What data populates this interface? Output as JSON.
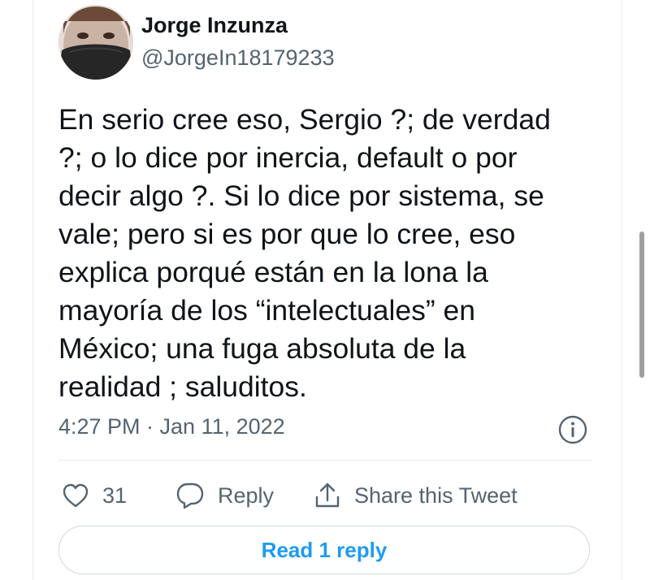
{
  "author": {
    "name": "Jorge Inzunza",
    "handle": "@JorgeIn18179233"
  },
  "tweet": {
    "text": "En serio cree eso, Sergio ?; de verdad\n?; o lo dice por inercia, default o por\ndecir algo ?. Si lo dice por sistema, se\nvale; pero si es por que lo cree, eso\nexplica porqué están en la lona la\nmayoría de los “intelectuales” en\nMéxico; una fuga absoluta de la\nrealidad ; saluditos.",
    "timestamp": "4:27 PM · Jan 11, 2022"
  },
  "actions": {
    "like_count": "31",
    "reply_label": "Reply",
    "share_label": "Share this Tweet"
  },
  "read_replies_label": "Read 1 reply",
  "colors": {
    "text_primary": "#0f1419",
    "text_secondary": "#536471",
    "accent": "#1d9bf0",
    "border": "#e6e9ec"
  },
  "icons": [
    "info-icon",
    "heart-icon",
    "reply-bubble-icon",
    "share-icon"
  ]
}
